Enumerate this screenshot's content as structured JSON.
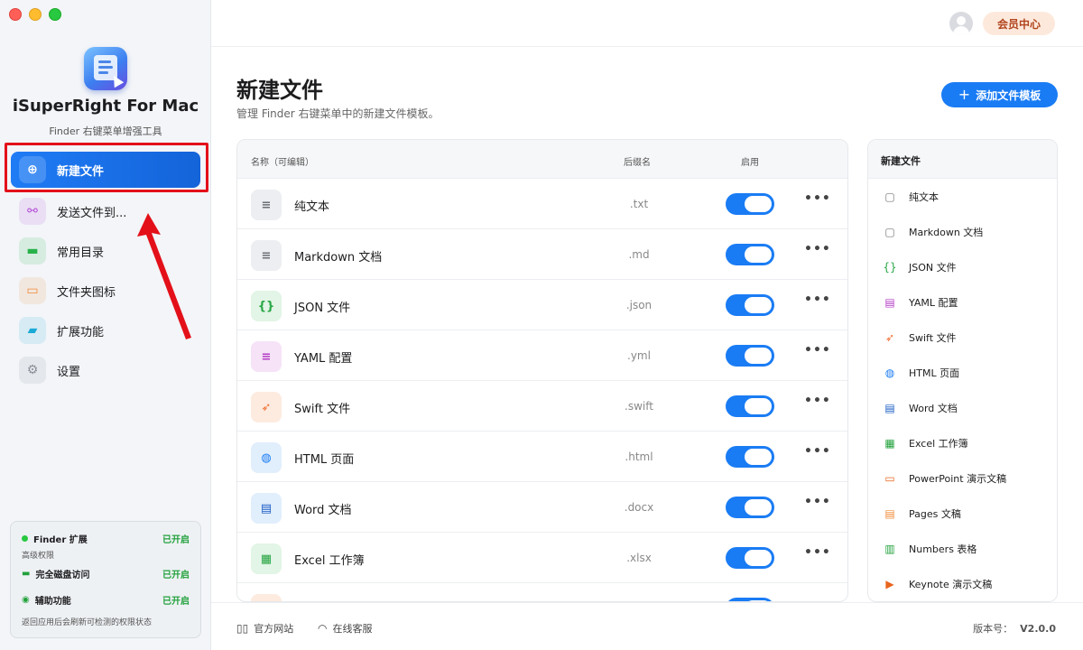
{
  "sidebar": {
    "app_name": "iSuperRight For Mac",
    "app_subtitle": "Finder 右键菜单增强工具",
    "items": [
      {
        "label": "新建文件",
        "icon": "new-file-icon",
        "color": "#1a7cf4",
        "active": true
      },
      {
        "label": "发送文件到...",
        "icon": "share-icon",
        "color": "#b24bd6"
      },
      {
        "label": "常用目录",
        "icon": "folder-icon",
        "color": "#28b24a"
      },
      {
        "label": "文件夹图标",
        "icon": "folder-image-icon",
        "color": "#f08c3a"
      },
      {
        "label": "扩展功能",
        "icon": "extension-icon",
        "color": "#1ba9d6"
      },
      {
        "label": "设置",
        "icon": "gear-icon",
        "color": "#8a8f98"
      }
    ],
    "permissions": {
      "finder_ext": "Finder 扩展",
      "finder_status": "已开启",
      "section": "高级权限",
      "disk_access": "完全磁盘访问",
      "disk_status": "已开启",
      "accessibility": "辅助功能",
      "accessibility_status": "已开启",
      "note": "返回应用后会刷新可检测的权限状态"
    }
  },
  "topbar": {
    "member_label": "会员中心"
  },
  "main": {
    "title": "新建文件",
    "subtitle": "管理 Finder 右键菜单中的新建文件模板。",
    "add_label": "添加文件模板",
    "columns": {
      "name": "名称（可编辑）",
      "ext": "后缀名",
      "enabled": "启用"
    },
    "rows": [
      {
        "name": "纯文本",
        "ext": ".txt",
        "icon": "text-doc-icon",
        "glyph": "≡",
        "bg": "#eceef1",
        "fg": "#6b6f76"
      },
      {
        "name": "Markdown 文档",
        "ext": ".md",
        "icon": "markdown-doc-icon",
        "glyph": "≡",
        "bg": "#eceef1",
        "fg": "#6b6f76"
      },
      {
        "name": "JSON 文件",
        "ext": ".json",
        "icon": "json-icon",
        "glyph": "{}",
        "bg": "#e2f5e6",
        "fg": "#28a745"
      },
      {
        "name": "YAML 配置",
        "ext": ".yml",
        "icon": "yaml-icon",
        "glyph": "≡",
        "bg": "#f6e3f8",
        "fg": "#b33ec4"
      },
      {
        "name": "Swift 文件",
        "ext": ".swift",
        "icon": "swift-icon",
        "glyph": "➶",
        "bg": "#fdebe0",
        "fg": "#f06a2c"
      },
      {
        "name": "HTML 页面",
        "ext": ".html",
        "icon": "globe-icon",
        "glyph": "◍",
        "bg": "#e1eefc",
        "fg": "#1a7cf4"
      },
      {
        "name": "Word 文档",
        "ext": ".docx",
        "icon": "word-icon",
        "glyph": "▤",
        "bg": "#e1eefc",
        "fg": "#1a5dc4"
      },
      {
        "name": "Excel 工作簿",
        "ext": ".xlsx",
        "icon": "excel-icon",
        "glyph": "▦",
        "bg": "#e2f5e6",
        "fg": "#21a13b"
      }
    ],
    "side_title": "新建文件",
    "side_items": [
      {
        "label": "纯文本",
        "icon": "text-doc-icon",
        "glyph": "▢",
        "fg": "#777"
      },
      {
        "label": "Markdown 文档",
        "icon": "markdown-doc-icon",
        "glyph": "▢",
        "fg": "#777"
      },
      {
        "label": "JSON 文件",
        "icon": "json-icon",
        "glyph": "{}",
        "fg": "#28a745"
      },
      {
        "label": "YAML 配置",
        "icon": "yaml-icon",
        "glyph": "▤",
        "fg": "#b33ec4"
      },
      {
        "label": "Swift 文件",
        "icon": "swift-icon",
        "glyph": "➶",
        "fg": "#f06a2c"
      },
      {
        "label": "HTML 页面",
        "icon": "globe-icon",
        "glyph": "◍",
        "fg": "#1a7cf4"
      },
      {
        "label": "Word 文档",
        "icon": "word-icon",
        "glyph": "▤",
        "fg": "#1a5dc4"
      },
      {
        "label": "Excel 工作簿",
        "icon": "excel-icon",
        "glyph": "▦",
        "fg": "#21a13b"
      },
      {
        "label": "PowerPoint 演示文稿",
        "icon": "powerpoint-icon",
        "glyph": "▭",
        "fg": "#e8641d"
      },
      {
        "label": "Pages 文稿",
        "icon": "pages-icon",
        "glyph": "▤",
        "fg": "#f08c3a"
      },
      {
        "label": "Numbers 表格",
        "icon": "numbers-icon",
        "glyph": "▥",
        "fg": "#21a13b"
      },
      {
        "label": "Keynote 演示文稿",
        "icon": "keynote-icon",
        "glyph": "▶",
        "fg": "#e8641d"
      }
    ]
  },
  "footer": {
    "website": "官方网站",
    "support": "在线客服",
    "version_label": "版本号：",
    "version": "V2.0.0"
  }
}
